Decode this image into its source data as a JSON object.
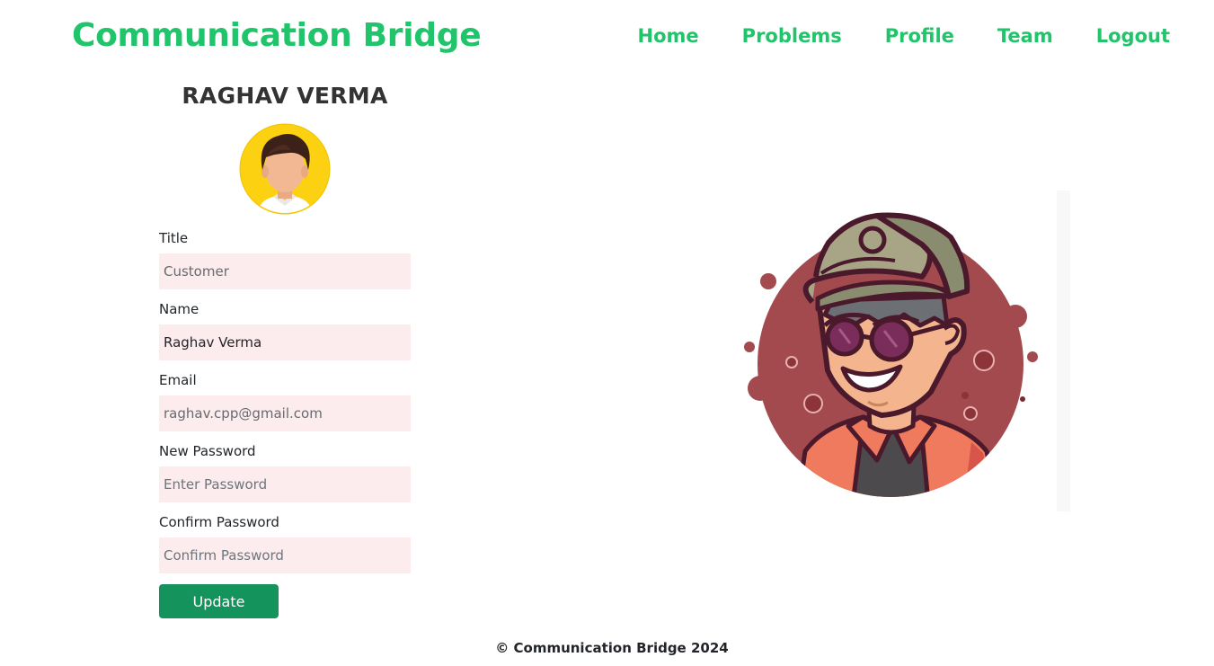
{
  "header": {
    "brand": "Communication Bridge",
    "nav": {
      "home": "Home",
      "problems": "Problems",
      "profile": "Profile",
      "team": "Team",
      "logout": "Logout"
    }
  },
  "profile": {
    "display_name": "RAGHAV VERMA",
    "form": {
      "title_label": "Title",
      "title_value": "Customer",
      "name_label": "Name",
      "name_value": "Raghav Verma",
      "email_label": "Email",
      "email_value": "raghav.cpp@gmail.com",
      "new_password_label": "New Password",
      "new_password_placeholder": "Enter Password",
      "confirm_password_label": "Confirm Password",
      "confirm_password_placeholder": "Confirm Password",
      "submit_label": "Update"
    }
  },
  "footer": {
    "text": "© Communication Bridge 2024"
  },
  "icons": {
    "avatar": "user-avatar-icon",
    "illustration": "cartoon-man-cap-sunglasses-illustration"
  },
  "colors": {
    "brand_green": "#20c46a",
    "button_green": "#14935c",
    "input_background": "#fdeced",
    "avatar_background": "#fbd112",
    "illustration_circle": "#a34a4e"
  }
}
